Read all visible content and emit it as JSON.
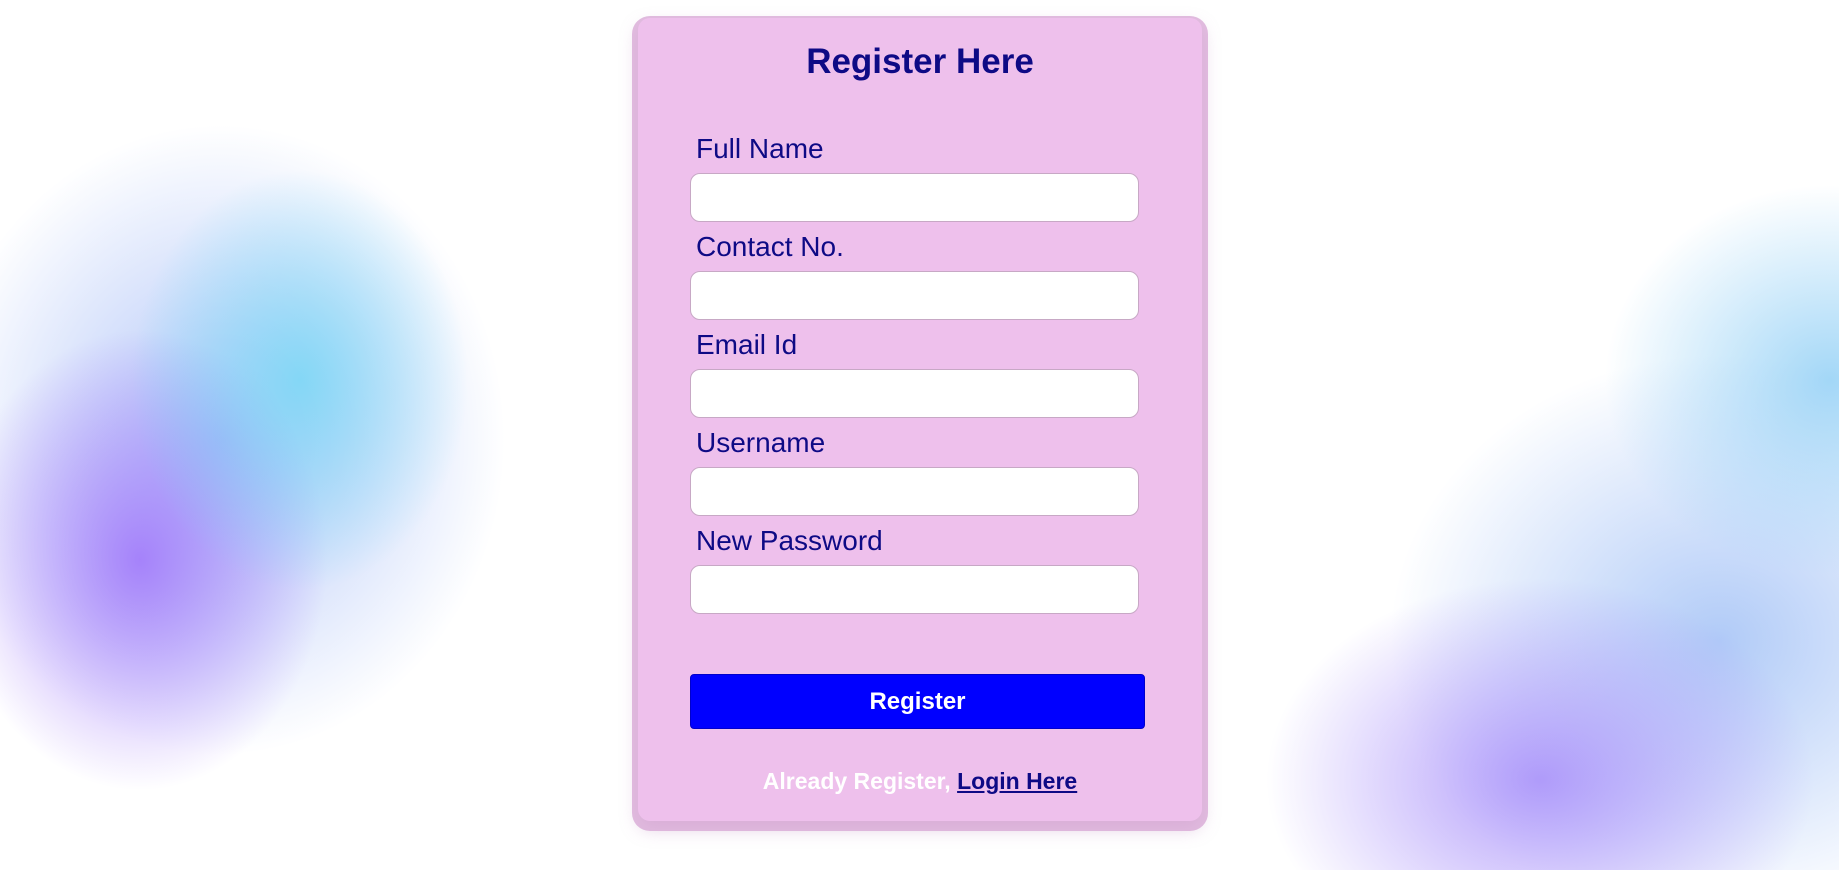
{
  "form": {
    "title": "Register Here",
    "fields": [
      {
        "label": "Full Name",
        "value": "",
        "placeholder": ""
      },
      {
        "label": "Contact No.",
        "value": "",
        "placeholder": ""
      },
      {
        "label": "Email Id",
        "value": "",
        "placeholder": ""
      },
      {
        "label": "Username",
        "value": "",
        "placeholder": ""
      },
      {
        "label": "New Password",
        "value": "",
        "placeholder": ""
      }
    ],
    "submit_label": "Register",
    "footer_text": "Already Register,",
    "login_link": "Login Here"
  },
  "colors": {
    "card_background": "#eec0ec",
    "heading_text": "#0e0a85",
    "button_background": "#0000ff",
    "button_text": "#ffffff",
    "footer_text": "#ffffff"
  }
}
